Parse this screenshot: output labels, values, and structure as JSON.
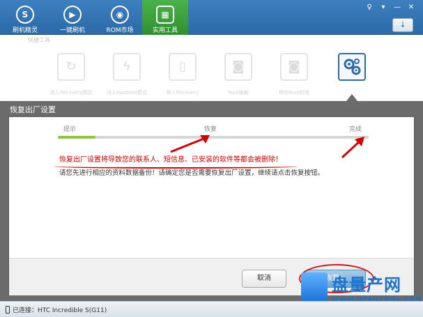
{
  "nav": {
    "items": [
      {
        "label": "刷机精灵",
        "icon": "s-logo-icon"
      },
      {
        "label": "一键刷机",
        "icon": "play-icon"
      },
      {
        "label": "ROM市场",
        "icon": "android-icon"
      },
      {
        "label": "实用工具",
        "icon": "grid-icon"
      }
    ],
    "active_index": 3
  },
  "window": {
    "refresh_glyph": "↓"
  },
  "tools": {
    "title": "快捷工具",
    "items": [
      {
        "label": "进入Recovery模式",
        "icon": "refresh-icon"
      },
      {
        "label": "进入Fastboot模式",
        "icon": "lightning-icon"
      },
      {
        "label": "刷入Recovery",
        "icon": "tablet-icon"
      },
      {
        "label": "Root破解",
        "icon": "android-icon"
      },
      {
        "label": "移除Root权限",
        "icon": "android-icon"
      },
      {
        "label": "",
        "icon": "gears-icon"
      }
    ],
    "selected_index": 5
  },
  "panel": {
    "title": "恢复出厂设置",
    "steps": [
      "提示",
      "恢复",
      "完成"
    ],
    "progress": 0.12,
    "warning": "恢复出厂设置将导致您的联系人、短信息、已安装的软件等都会被删除！",
    "info": "请您先进行相应的资料数据备份！请确定您是否需要恢复出厂设置，继续请点击恢复按钮。",
    "cancel_label": "取消",
    "restore_label": "恢复 ▸"
  },
  "status": {
    "text": "已连接：HTC Incredible S(G11)"
  },
  "watermark": {
    "brand": "盘量产网",
    "url": "WWW.UPANTOOL.COM"
  },
  "colors": {
    "accent_blue": "#2c6aa8",
    "active_green": "#3aa83a",
    "warning_red": "#d00000",
    "progress_green": "#8cc63f"
  }
}
